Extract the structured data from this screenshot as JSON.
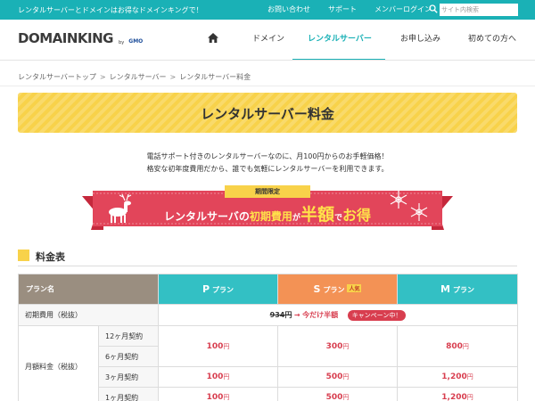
{
  "topbar": {
    "tagline": "レンタルサーバーとドメインはお得なドメインキングで！",
    "links": [
      "お問い合わせ",
      "サポート",
      "メンバーログイン"
    ],
    "search_placeholder": "サイト内検索"
  },
  "header": {
    "logo_main": "DOMAINKING",
    "logo_by": "by",
    "logo_gmo": "GMO",
    "nav": [
      {
        "label": "ドメイン"
      },
      {
        "label": "レンタルサーバー",
        "active": true
      },
      {
        "label": "お申し込み"
      },
      {
        "label": "初めての方へ"
      }
    ]
  },
  "breadcrumb": [
    "レンタルサーバートップ",
    "レンタルサーバー",
    "レンタルサーバー料金"
  ],
  "page_title": "レンタルサーバー料金",
  "intro": {
    "line1": "電話サポート付きのレンタルサーバーなのに、月100円からのお手軽価格！",
    "line2": "格安な初年度費用だから、誰でも気軽にレンタルサーバーを利用できます。"
  },
  "campaign": {
    "badge": "期間限定",
    "s1": "レンタルサーバの",
    "s2": "初期費用",
    "s3": "が",
    "s4": "半額",
    "s5": "で",
    "s6": "お得"
  },
  "section_title": "料金表",
  "table": {
    "plan_label": "プラン名",
    "plan_suffix": "プラン",
    "plans": [
      "P",
      "S",
      "M"
    ],
    "popular_badge": "人気",
    "initial_label": "初期費用（税抜）",
    "initial_old": "934円",
    "initial_arrow": "→",
    "initial_new": "今だけ半額",
    "campaign_tag": "キャンペーン中！",
    "monthly_label": "月額料金（税抜）",
    "yen": "円",
    "rows": [
      {
        "term": "12ヶ月契約",
        "prices": [
          "100",
          "300",
          "800"
        ]
      },
      {
        "term": "6ヶ月契約",
        "prices": [
          "",
          "",
          ""
        ]
      },
      {
        "term": "3ヶ月契約",
        "prices": [
          "100",
          "500",
          "1,200"
        ]
      },
      {
        "term": "1ヶ月契約",
        "prices": [
          "100",
          "500",
          "1,200"
        ]
      }
    ]
  },
  "colors": {
    "teal": "#1ab1b6",
    "yellow": "#f8d24a",
    "orange": "#f39255",
    "red": "#d83e4f",
    "taupe": "#9a8e80"
  }
}
